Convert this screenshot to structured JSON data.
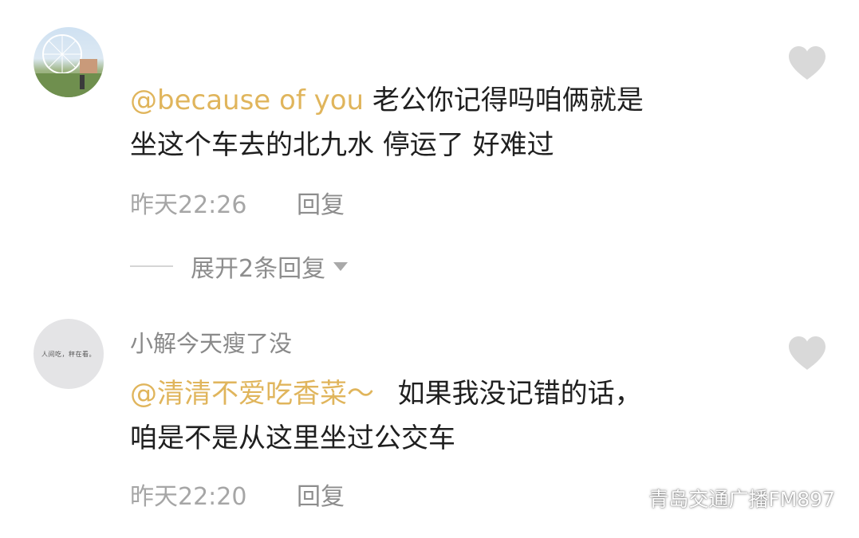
{
  "comments": [
    {
      "username": "",
      "mention": "@because of you",
      "text_line1": "老公你记得吗咱俩就是",
      "text_line2": "坐这个车去的北九水 停运了 好难过",
      "time": "昨天22:26",
      "reply_label": "回复",
      "expand_label": "展开2条回复"
    },
    {
      "username": "小解今天瘦了没",
      "avatar_text": "人间吃，秤在看。",
      "mention": "@清清不爱吃香菜～",
      "text_line1": "如果我没记错的话，",
      "text_line2": "咱是不是从这里坐过公交车",
      "time": "昨天22:20",
      "reply_label": "回复"
    }
  ],
  "watermark": {
    "text": "青岛交通广播FM897",
    "icon": "wechat-icon"
  },
  "colors": {
    "mention": "#e0b55c",
    "heart": "#d9d9d9",
    "meta": "#a6a6a6"
  }
}
